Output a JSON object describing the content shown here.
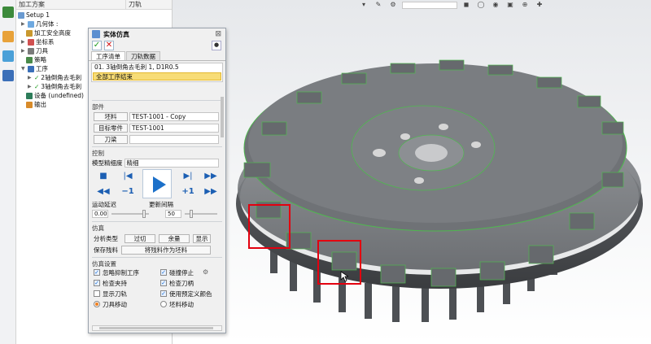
{
  "tree": {
    "header": {
      "col1": "加工方案",
      "col2": "刀轨"
    },
    "items": [
      {
        "label": "Setup 1"
      },
      {
        "label": "几何体 :"
      },
      {
        "label": "加工安全高度"
      },
      {
        "label": "坐标系"
      },
      {
        "label": "刀具"
      },
      {
        "label": "策略"
      },
      {
        "label": "工序"
      },
      {
        "label": "2轴倒角去毛刺"
      },
      {
        "label": "3轴倒角去毛刺"
      },
      {
        "label": "设备 (undefined)"
      },
      {
        "label": "输出"
      }
    ]
  },
  "dialog": {
    "title": "实体仿真",
    "tabs": [
      "工序清单",
      "刀轨数据"
    ],
    "operations": [
      "01. 3轴倒角去毛刺 1, D1R0.5",
      "全部工序结束"
    ],
    "parts_section": "部件",
    "stock_label": "坯料",
    "stock_value": "TEST-1001 - Copy",
    "target_label": "目标零件",
    "target_value": "TEST-1001",
    "holder_label": "刀梁",
    "holder_value": "",
    "control_section": "控制",
    "precision_label": "模型精细度",
    "precision_value": "精细",
    "step_back": "−1",
    "step_fwd": "+1",
    "delay_label": "运动延迟",
    "delay_value": "0.00",
    "interval_label": "更新间隔",
    "interval_value": "50",
    "sim_section": "仿真",
    "analysis_label": "分析类型",
    "btn_overcut": "过切",
    "btn_remain": "余量",
    "btn_show": "显示",
    "save_label": "保存残料",
    "save_btn": "将残料作为坯料",
    "settings_section": "仿真设置",
    "cb_skip": "忽略抑制工序",
    "cb_collision_stop": "碰撞停止",
    "cb_check_holder": "检查夹持",
    "cb_check_tool": "检查刀柄",
    "cb_show_path": "显示刀轨",
    "cb_predef_color": "使用预定义颜色",
    "radio_tool": "刀具移动",
    "radio_stock": "坯料移动"
  },
  "colors": {
    "highlight": "#f7dc76",
    "annotation": "#e3000f",
    "accent": "#1c70c9"
  }
}
